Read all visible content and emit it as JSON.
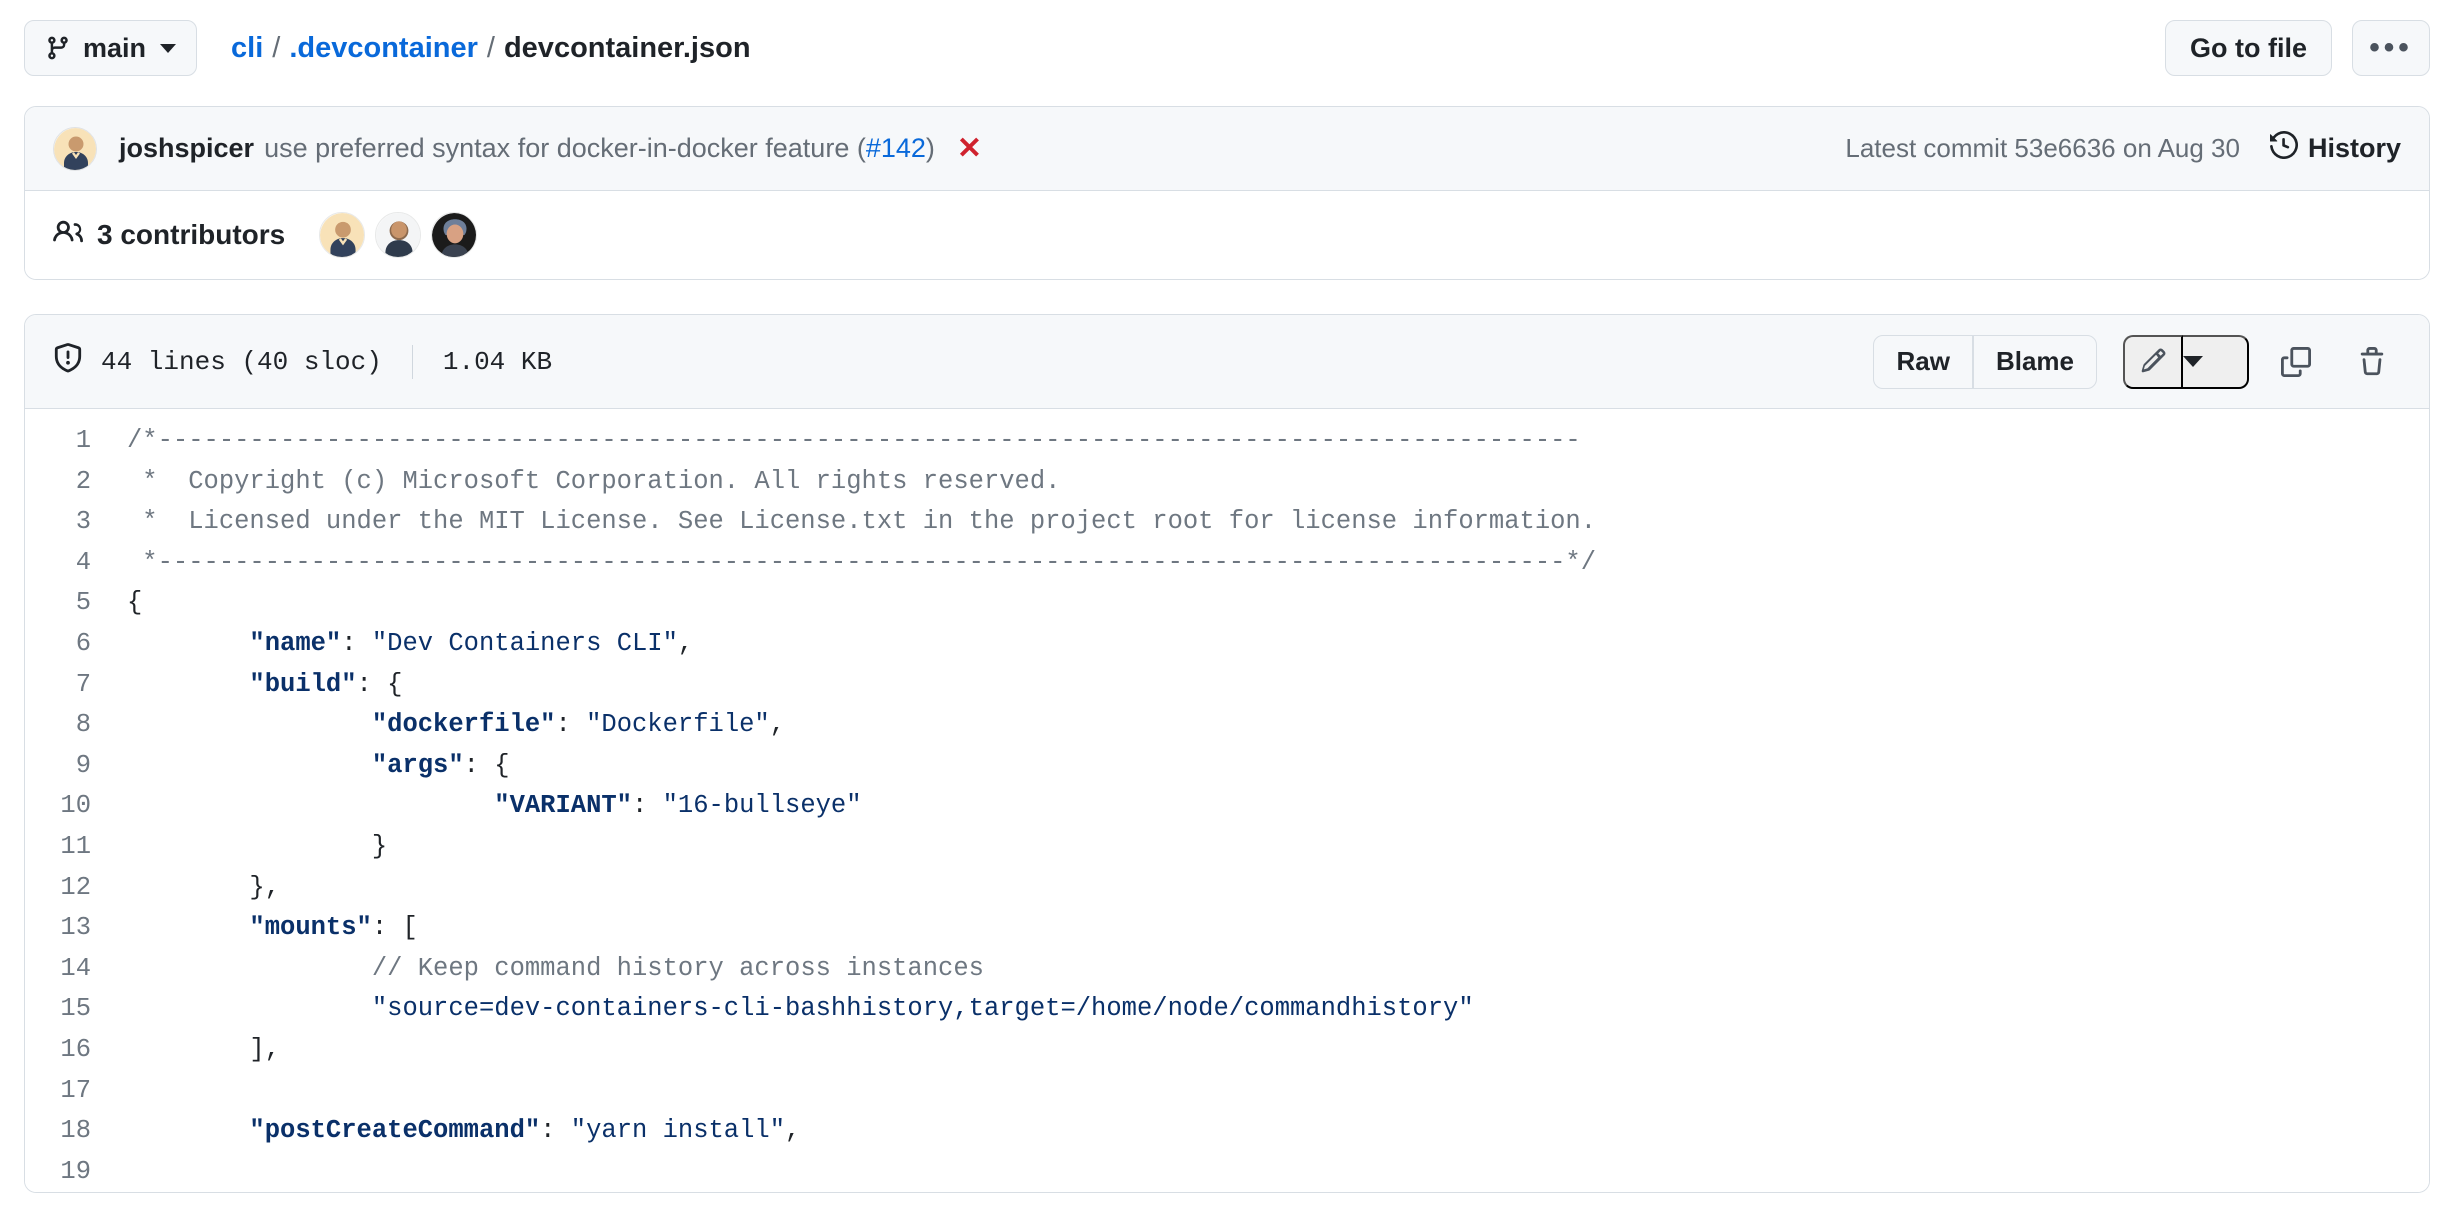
{
  "topbar": {
    "branch_icon": "git-branch-icon",
    "branch_name": "main",
    "breadcrumb": {
      "repo": "cli",
      "folder": ".devcontainer",
      "file": "devcontainer.json",
      "separator": "/"
    },
    "go_to_file_label": "Go to file",
    "kebab_label": "•••"
  },
  "commit": {
    "author": "joshspicer",
    "message": "use preferred syntax for docker-in-docker feature (",
    "pr_link": "#142",
    "message_end": ")",
    "status_icon": "x-failed-icon",
    "status_glyph": "✕",
    "latest_commit_text": "Latest commit 53e6636 on Aug 30",
    "history_label": "History",
    "history_icon": "history-clock-icon"
  },
  "contributors": {
    "icon": "people-icon",
    "label": "3 contributors",
    "count": 3
  },
  "file": {
    "shield_icon": "shield-lock-icon",
    "lines_label": "44 lines (40 sloc)",
    "size_label": "1.04 KB",
    "raw_label": "Raw",
    "blame_label": "Blame",
    "edit_icon": "pencil-icon",
    "edit_dropdown_icon": "chevron-down-icon",
    "copy_icon": "copy-icon",
    "delete_icon": "trash-icon"
  },
  "code": {
    "language": "json",
    "lines": [
      {
        "n": 1,
        "tokens": [
          {
            "t": "comment",
            "s": "/*---------------------------------------------------------------------------------------------"
          }
        ]
      },
      {
        "n": 2,
        "tokens": [
          {
            "t": "comment",
            "s": " *  Copyright (c) Microsoft Corporation. All rights reserved."
          }
        ]
      },
      {
        "n": 3,
        "tokens": [
          {
            "t": "comment",
            "s": " *  Licensed under the MIT License. See License.txt in the project root for license information."
          }
        ]
      },
      {
        "n": 4,
        "tokens": [
          {
            "t": "comment",
            "s": " *--------------------------------------------------------------------------------------------*/"
          }
        ]
      },
      {
        "n": 5,
        "tokens": [
          {
            "t": "punct",
            "s": "{"
          }
        ]
      },
      {
        "n": 6,
        "tokens": [
          {
            "t": "punct",
            "s": "\t"
          },
          {
            "t": "key",
            "s": "\"name\""
          },
          {
            "t": "punct",
            "s": ": "
          },
          {
            "t": "str",
            "s": "\"Dev Containers CLI\""
          },
          {
            "t": "punct",
            "s": ","
          }
        ]
      },
      {
        "n": 7,
        "tokens": [
          {
            "t": "punct",
            "s": "\t"
          },
          {
            "t": "key",
            "s": "\"build\""
          },
          {
            "t": "punct",
            "s": ": {"
          }
        ]
      },
      {
        "n": 8,
        "tokens": [
          {
            "t": "punct",
            "s": "\t\t"
          },
          {
            "t": "key",
            "s": "\"dockerfile\""
          },
          {
            "t": "punct",
            "s": ": "
          },
          {
            "t": "str",
            "s": "\"Dockerfile\""
          },
          {
            "t": "punct",
            "s": ","
          }
        ]
      },
      {
        "n": 9,
        "tokens": [
          {
            "t": "punct",
            "s": "\t\t"
          },
          {
            "t": "key",
            "s": "\"args\""
          },
          {
            "t": "punct",
            "s": ": {"
          }
        ]
      },
      {
        "n": 10,
        "tokens": [
          {
            "t": "punct",
            "s": "\t\t\t"
          },
          {
            "t": "key",
            "s": "\"VARIANT\""
          },
          {
            "t": "punct",
            "s": ": "
          },
          {
            "t": "str",
            "s": "\"16-bullseye\""
          }
        ]
      },
      {
        "n": 11,
        "tokens": [
          {
            "t": "punct",
            "s": "\t\t}"
          }
        ]
      },
      {
        "n": 12,
        "tokens": [
          {
            "t": "punct",
            "s": "\t},"
          }
        ]
      },
      {
        "n": 13,
        "tokens": [
          {
            "t": "punct",
            "s": "\t"
          },
          {
            "t": "key",
            "s": "\"mounts\""
          },
          {
            "t": "punct",
            "s": ": ["
          }
        ]
      },
      {
        "n": 14,
        "tokens": [
          {
            "t": "punct",
            "s": "\t\t"
          },
          {
            "t": "comment",
            "s": "// Keep command history across instances"
          }
        ]
      },
      {
        "n": 15,
        "tokens": [
          {
            "t": "punct",
            "s": "\t\t"
          },
          {
            "t": "str",
            "s": "\"source=dev-containers-cli-bashhistory,target=/home/node/commandhistory\""
          }
        ]
      },
      {
        "n": 16,
        "tokens": [
          {
            "t": "punct",
            "s": "\t],"
          }
        ]
      },
      {
        "n": 17,
        "tokens": [
          {
            "t": "punct",
            "s": ""
          }
        ]
      },
      {
        "n": 18,
        "tokens": [
          {
            "t": "punct",
            "s": "\t"
          },
          {
            "t": "key",
            "s": "\"postCreateCommand\""
          },
          {
            "t": "punct",
            "s": ": "
          },
          {
            "t": "str",
            "s": "\"yarn install\""
          },
          {
            "t": "punct",
            "s": ","
          }
        ]
      },
      {
        "n": 19,
        "tokens": [
          {
            "t": "punct",
            "s": ""
          }
        ]
      }
    ]
  },
  "colors": {
    "link": "#0969da",
    "text": "#1f2328",
    "muted": "#656d76",
    "border": "#d8dee4",
    "canvas_subtle": "#f6f8fa",
    "danger": "#cf222e",
    "code_string": "#0a3069",
    "code_comment": "#6e7781"
  }
}
